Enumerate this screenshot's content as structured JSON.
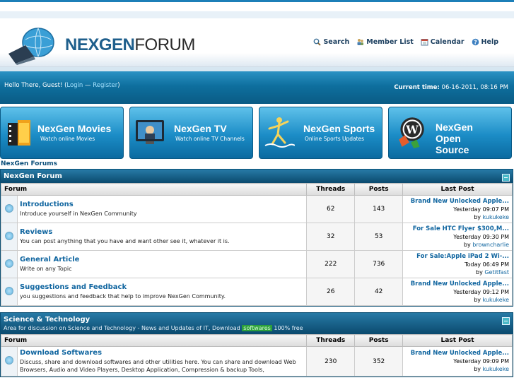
{
  "site": {
    "logo_main": "NEXGEN",
    "logo_sub": "FORUM"
  },
  "toplinks": [
    {
      "label": "Search",
      "icon": "search-icon"
    },
    {
      "label": "Member List",
      "icon": "members-icon"
    },
    {
      "label": "Calendar",
      "icon": "calendar-icon"
    },
    {
      "label": "Help",
      "icon": "help-icon"
    }
  ],
  "welcome": {
    "greeting": "Hello There, Guest! (",
    "login": "Login",
    "sep": " — ",
    "register": "Register",
    "close": ")",
    "time_label": "Current time:",
    "time_value": " 06-16-2011, 08:16 PM"
  },
  "banners": [
    {
      "title": "NexGen Movies",
      "sub": "Watch online Movies"
    },
    {
      "title": "NexGen TV",
      "sub": "Watch online TV Channels"
    },
    {
      "title": "NexGen Sports",
      "sub": "Online Sports Updates"
    },
    {
      "title": "NexGen Open Source",
      "sub": ""
    }
  ],
  "breadcrumb": "NexGen Forums",
  "headers": {
    "forum": "Forum",
    "threads": "Threads",
    "posts": "Posts",
    "last": "Last Post"
  },
  "categories": [
    {
      "title": "NexGen Forum",
      "desc_before": "",
      "desc_highlight": "",
      "desc_after": "",
      "forums": [
        {
          "name": "Introductions",
          "desc": "Introduce yourself in NexGen Community",
          "threads": "62",
          "posts": "143",
          "last_title": "Brand New Unlocked Apple...",
          "last_time": "Yesterday 09:07 PM",
          "last_by": "by ",
          "last_user": "kukukeke"
        },
        {
          "name": "Reviews",
          "desc": "You can post anything that you have and want other see it, whatever it is.",
          "threads": "32",
          "posts": "53",
          "last_title": "For Sale HTC Flyer $300,M...",
          "last_time": "Yesterday 09:30 PM",
          "last_by": "by ",
          "last_user": "browncharlie"
        },
        {
          "name": "General Article",
          "desc": "Write on any Topic",
          "threads": "222",
          "posts": "736",
          "last_title": "For Sale:Apple iPad 2 Wi-...",
          "last_time": "Today 06:49 PM",
          "last_by": "by ",
          "last_user": "Getitfast"
        },
        {
          "name": "Suggestions and Feedback",
          "desc": "you suggestions and feedback that help to improve NexGen Community.",
          "threads": "26",
          "posts": "42",
          "last_title": "Brand New Unlocked Apple...",
          "last_time": "Yesterday 09:12 PM",
          "last_by": "by ",
          "last_user": "kukukeke"
        }
      ]
    },
    {
      "title": "Science & Technology",
      "desc_before": "Area for discussion on Science and Technology - News and Updates of IT, Download ",
      "desc_highlight": "softwares",
      "desc_after": " 100% free",
      "forums": [
        {
          "name": "Download Softwares",
          "desc": "Discuss, share and download softwares and other utilities here. You can share and download Web Browsers, Audio and Video Players, Desktop Application, Compression & backup Tools,",
          "threads": "230",
          "posts": "352",
          "last_title": "Brand New Unlocked Apple...",
          "last_time": "Yesterday 09:09 PM",
          "last_by": "by ",
          "last_user": "kukukeke"
        }
      ]
    }
  ]
}
